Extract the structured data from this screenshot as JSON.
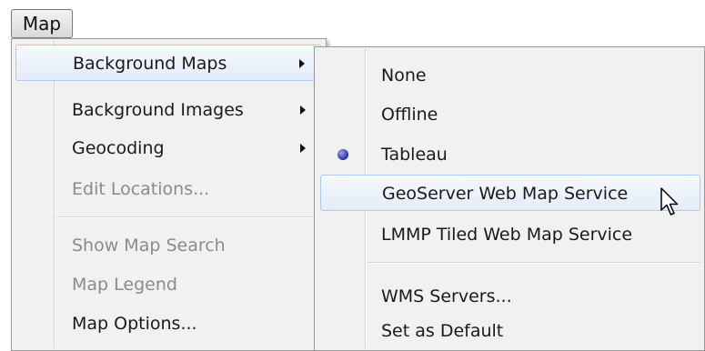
{
  "menubar": {
    "map_label": "Map"
  },
  "primary_menu": {
    "items": [
      {
        "label": "Background Maps",
        "has_submenu": true,
        "highlighted": true,
        "disabled": false
      },
      {
        "label": "Background Images",
        "has_submenu": true,
        "disabled": false
      },
      {
        "label": "Geocoding",
        "has_submenu": true,
        "disabled": false
      },
      {
        "label": "Edit Locations...",
        "disabled": true
      },
      {
        "label": "Show Map Search",
        "disabled": true
      },
      {
        "label": "Map Legend",
        "disabled": true
      },
      {
        "label": "Map Options...",
        "disabled": false
      }
    ]
  },
  "submenu": {
    "items": [
      {
        "label": "None",
        "selected": false
      },
      {
        "label": "Offline",
        "selected": false
      },
      {
        "label": "Tableau",
        "selected": true
      },
      {
        "label": "GeoServer Web Map Service",
        "selected": false,
        "hovered": true
      },
      {
        "label": "LMMP Tiled Web Map Service",
        "selected": false
      },
      {
        "label": "WMS Servers...",
        "selected": false
      },
      {
        "label": "Set as Default",
        "selected": false
      }
    ]
  },
  "colors": {
    "highlight_border": "#aecbef",
    "menu_background": "#f1f1f1",
    "disabled_text": "#8b8b8b",
    "radio_dot": "#2a2f9a"
  }
}
